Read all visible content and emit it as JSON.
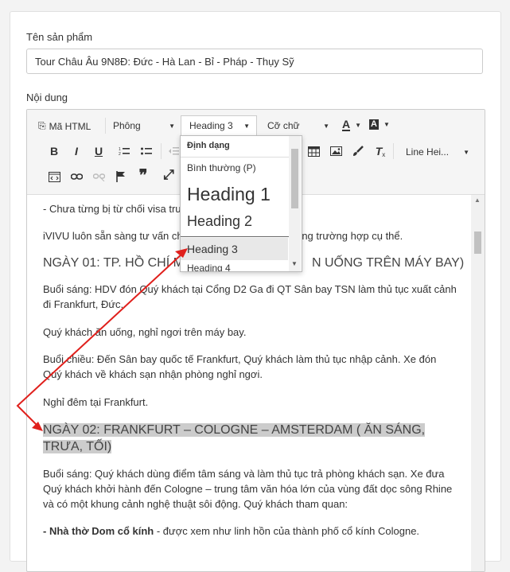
{
  "form": {
    "product_label": "Tên sản phẩm",
    "product_value": "Tour Châu Âu 9N8Đ: Đức - Hà Lan - Bỉ - Pháp - Thụy Sỹ",
    "content_label": "Nội dung"
  },
  "toolbar": {
    "html_button": "Mã HTML",
    "font_dropdown": "Phông",
    "format_dropdown": "Heading 3",
    "size_dropdown": "Cỡ chữ",
    "text_color": "A",
    "bg_color": "A",
    "line_height": "Line Hei...",
    "bold": "B",
    "italic": "I",
    "underline": "U",
    "quote": "❞",
    "fullscreen": "⤢"
  },
  "dropdown": {
    "header": "Định dạng",
    "items": [
      "Bình thường (P)",
      "Heading 1",
      "Heading 2",
      "Heading 3",
      "Heading 4"
    ]
  },
  "content": {
    "line1": "- Chưa từng bị từ chối visa tru",
    "line2": "iVIVU luôn sẵn sàng tư vấn ch",
    "line2b": "từng trường hợp cụ thể.",
    "day1_heading": "NGÀY 01: TP. HỒ CHÍ MI",
    "day1_heading_end": "N UỐNG TRÊN MÁY BAY)",
    "p1": "Buổi sáng: HDV đón Quý khách tại Cổng D2 Ga đi QT Sân bay TSN làm thủ tục xuất cảnh đi Frankfurt, Đức.",
    "p2": "Quý khách ăn uống, nghỉ ngơi trên máy bay.",
    "p3": "Buổi chiều: Đến Sân bay quốc tế Frankfurt, Quý khách làm thủ tục nhập cảnh. Xe đón Quý khách về khách sạn nhận phòng nghỉ ngơi.",
    "p4": "Nghỉ đêm tại Frankfurt.",
    "day2_heading": "NGÀY 02: FRANKFURT – COLOGNE – AMSTERDAM ( ĂN SÁNG, TRƯA, TỐI)",
    "p5": "Buổi sáng: Quý khách dùng điểm tâm sáng và làm thủ tục trả phòng khách sạn. Xe đưa Quý khách khởi hành đến Cologne – trung tâm văn hóa lớn của vùng đất dọc sông Rhine và có một khung cảnh nghệ thuật sôi động. Quý khách tham quan:",
    "p6_bold": "- Nhà thờ Dom cổ kính",
    "p6_rest": " - được xem như linh hồn của thành phố cổ kính Cologne."
  },
  "colors": {
    "annotation_arrow": "#e0201c"
  }
}
